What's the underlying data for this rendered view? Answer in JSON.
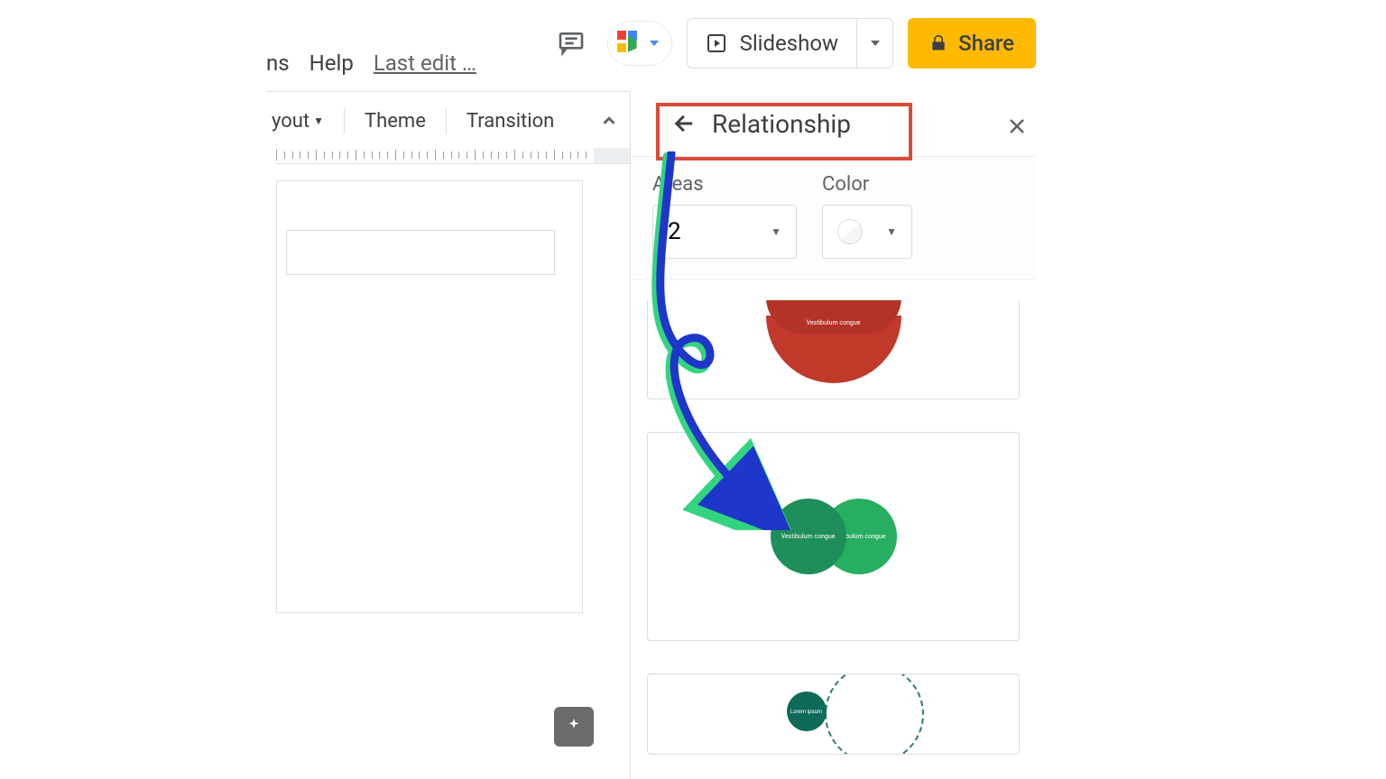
{
  "menu": {
    "partial_item": "ns",
    "help": "Help",
    "last_edit": "Last edit …"
  },
  "top": {
    "slideshow_label": "Slideshow",
    "share_label": "Share"
  },
  "toolbar": {
    "layout": "yout",
    "theme": "Theme",
    "transition": "Transition"
  },
  "panel": {
    "title": "Relationship",
    "areas_label": "Areas",
    "areas_value": "2",
    "color_label": "Color"
  },
  "templates": {
    "t1_text": "Vestibulum congue",
    "t2_text1": "Vestibulum congue",
    "t2_text2": "Vestibulum congue",
    "t3_text": "Lorem ipsum"
  }
}
